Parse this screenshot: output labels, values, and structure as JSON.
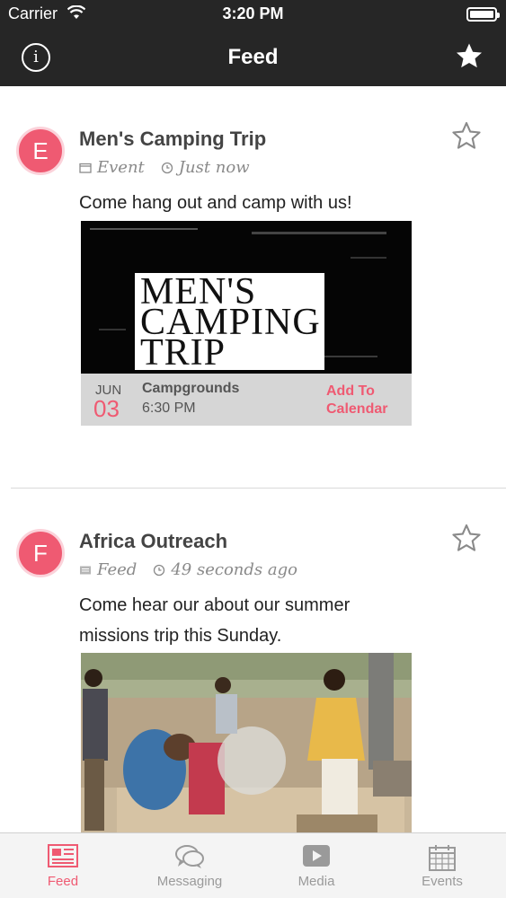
{
  "status_bar": {
    "carrier": "Carrier",
    "time": "3:20 PM"
  },
  "nav": {
    "title": "Feed",
    "info_glyph": "i",
    "left_icon": "info-icon",
    "right_icon": "star-filled-icon"
  },
  "colors": {
    "accent": "#ef5a72",
    "nav_bg": "#262626",
    "strip_bg": "#d6d6d6"
  },
  "feed": [
    {
      "avatar_letter": "E",
      "title": "Men's Camping Trip",
      "type_icon": "calendar-icon",
      "type": "Event",
      "time_icon": "clock-icon",
      "time": "Just now",
      "body": "Come hang out and camp with us!",
      "image_title_lines": [
        "MEN'S",
        "CAMPING",
        "TRIP"
      ],
      "event": {
        "month": "JUN",
        "day": "03",
        "location": "Campgrounds",
        "time": "6:30 PM",
        "add_line1": "Add To",
        "add_line2": "Calendar"
      }
    },
    {
      "avatar_letter": "F",
      "title": "Africa Outreach",
      "type_icon": "newspaper-icon",
      "type": "Feed",
      "time_icon": "clock-icon",
      "time": "49 seconds ago",
      "body_line1": "Come hear our about our summer",
      "body_line2": "missions trip this Sunday."
    }
  ],
  "tabs": [
    {
      "label": "Feed",
      "icon": "feed-icon",
      "active": true
    },
    {
      "label": "Messaging",
      "icon": "chat-bubbles-icon",
      "active": false
    },
    {
      "label": "Media",
      "icon": "play-icon",
      "active": false
    },
    {
      "label": "Events",
      "icon": "calendar-grid-icon",
      "active": false
    }
  ]
}
